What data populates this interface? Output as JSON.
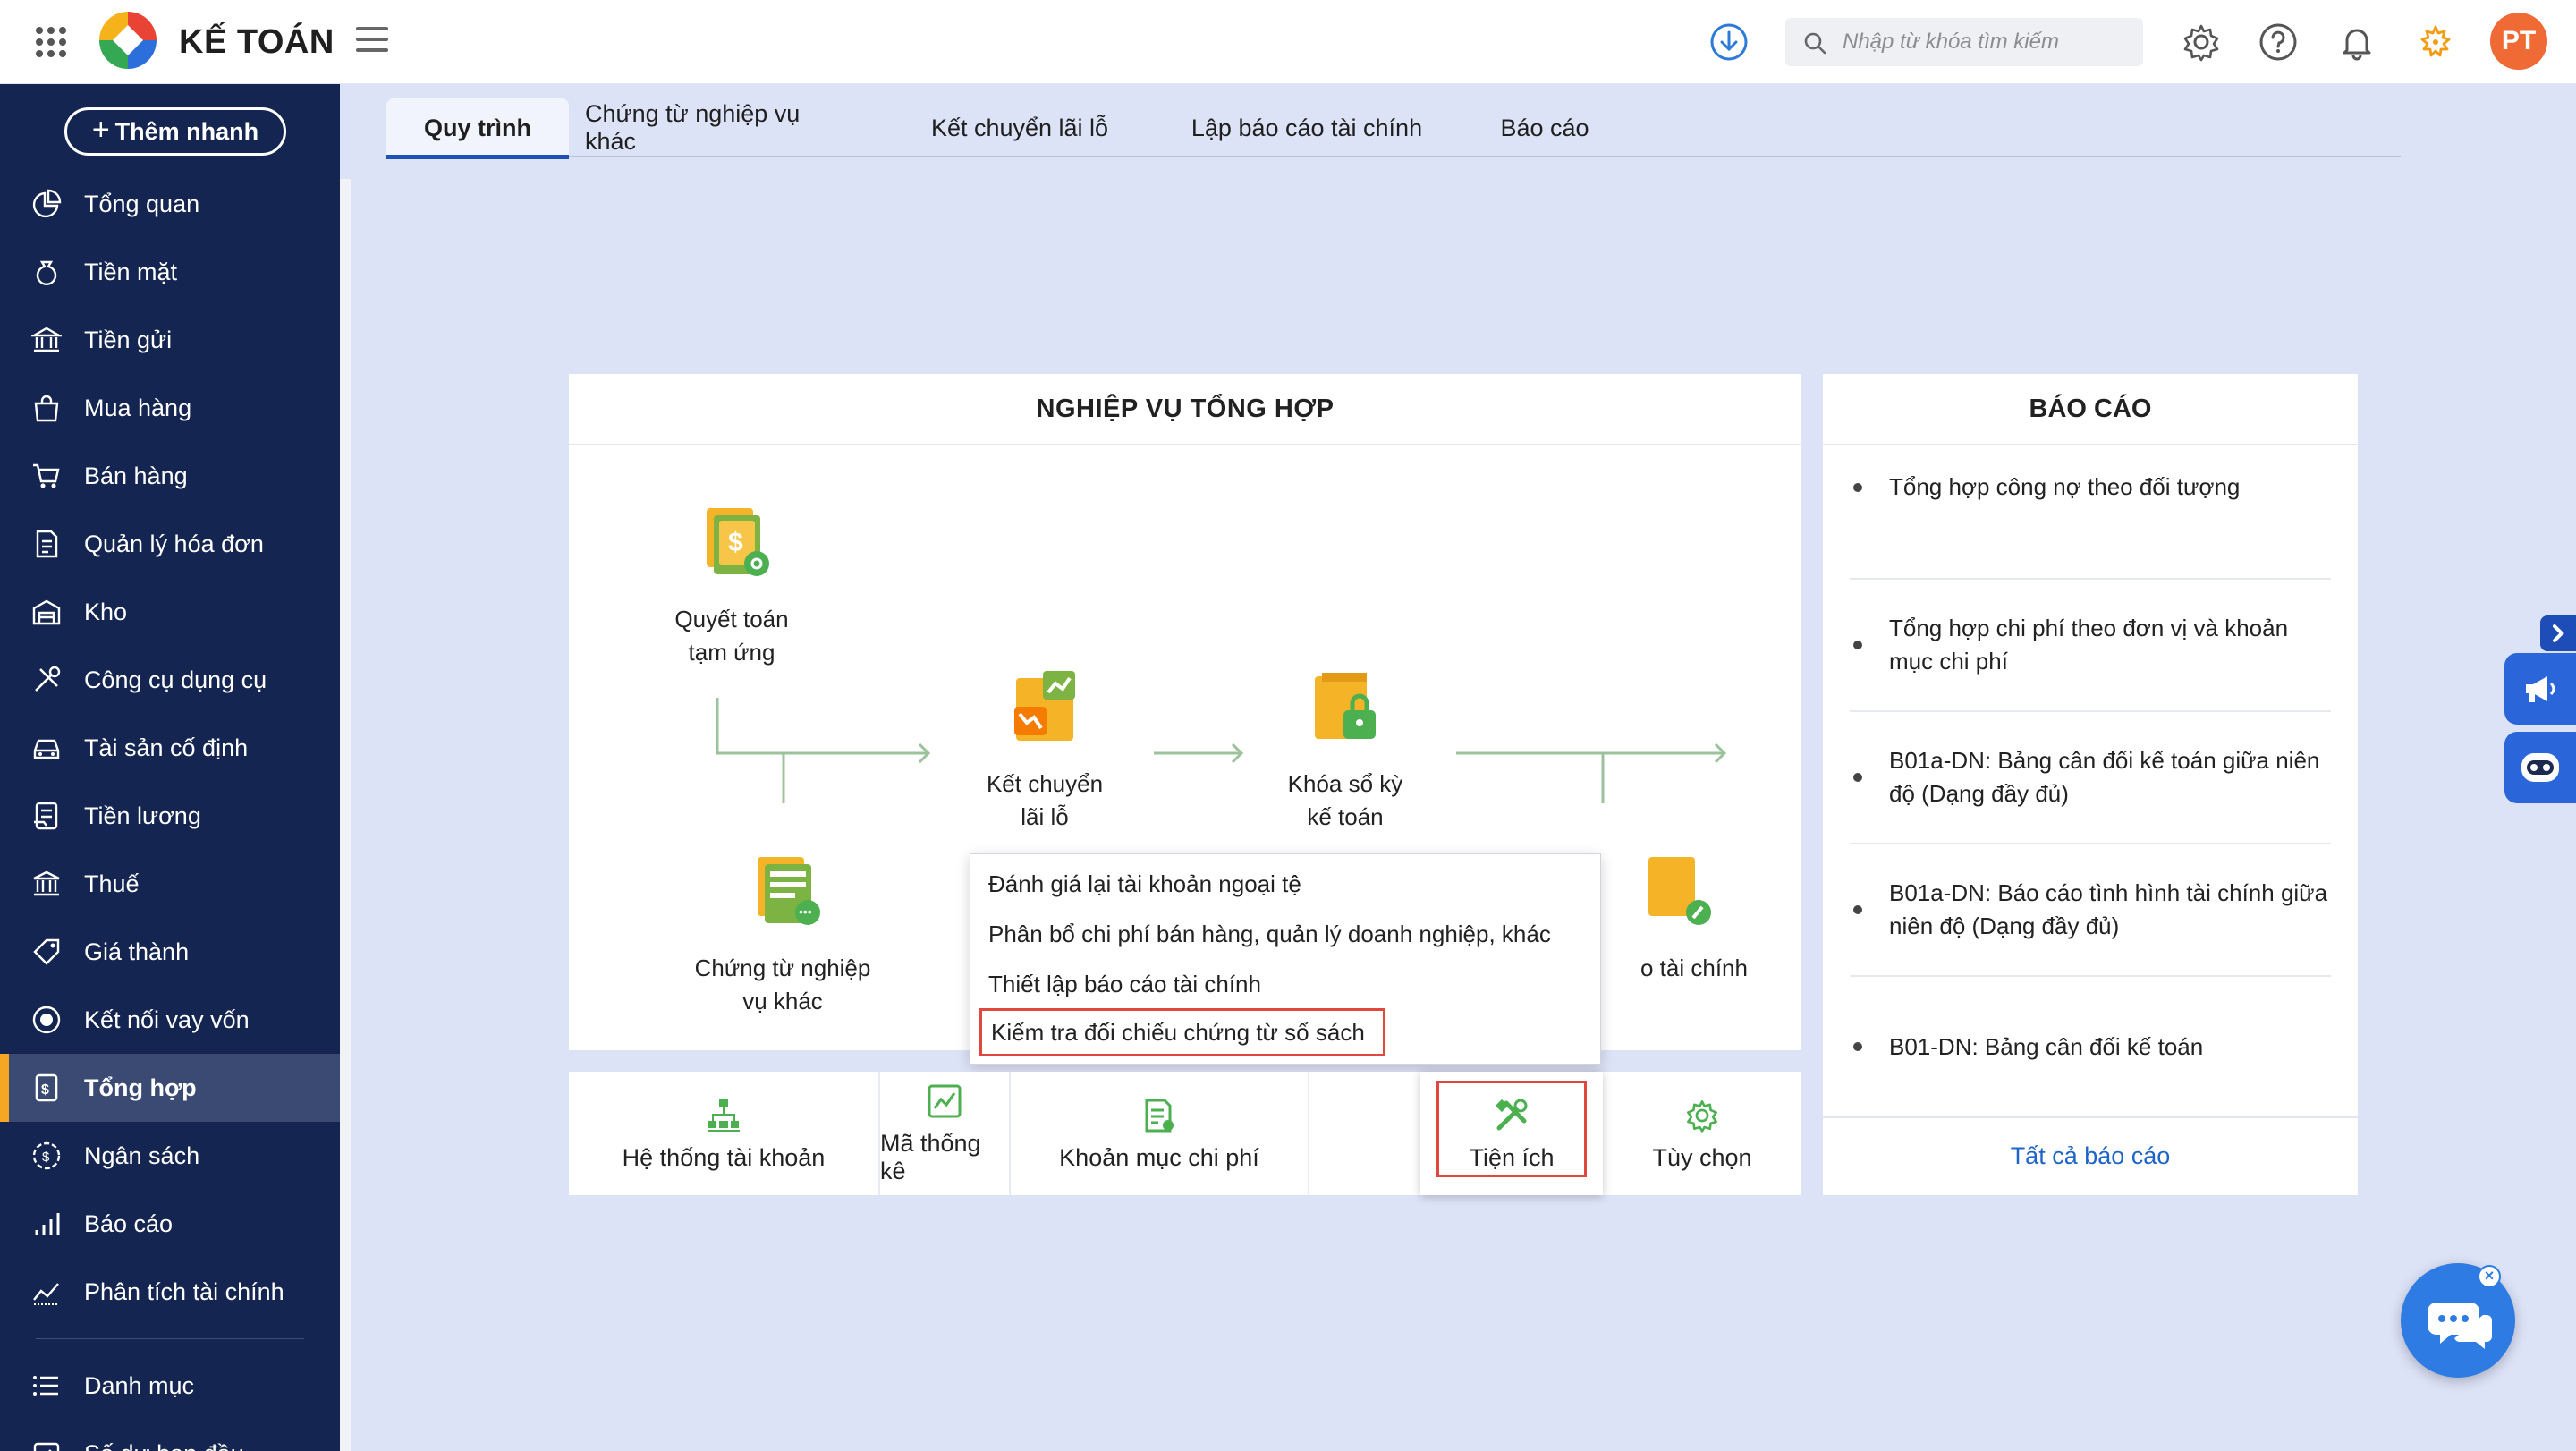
{
  "app": {
    "title": "KẾ TOÁN"
  },
  "search": {
    "placeholder": "Nhập từ khóa tìm kiếm"
  },
  "user": {
    "initials": "PT"
  },
  "sidebar": {
    "add_label": "Thêm nhanh",
    "items": [
      {
        "label": "Tổng quan",
        "icon": "chart-pie-icon"
      },
      {
        "label": "Tiền mặt",
        "icon": "money-bag-icon"
      },
      {
        "label": "Tiền gửi",
        "icon": "bank-icon"
      },
      {
        "label": "Mua hàng",
        "icon": "shopping-bag-icon"
      },
      {
        "label": "Bán hàng",
        "icon": "cart-icon"
      },
      {
        "label": "Quản lý hóa đơn",
        "icon": "invoice-icon"
      },
      {
        "label": "Kho",
        "icon": "warehouse-icon"
      },
      {
        "label": "Công cụ dụng cụ",
        "icon": "tools-icon"
      },
      {
        "label": "Tài sản cố định",
        "icon": "car-icon"
      },
      {
        "label": "Tiền lương",
        "icon": "salary-icon"
      },
      {
        "label": "Thuế",
        "icon": "tax-icon"
      },
      {
        "label": "Giá thành",
        "icon": "price-tag-icon"
      },
      {
        "label": "Kết nối vay vốn",
        "icon": "loan-icon"
      },
      {
        "label": "Tổng hợp",
        "icon": "ledger-icon",
        "active": true
      },
      {
        "label": "Ngân sách",
        "icon": "budget-icon"
      },
      {
        "label": "Báo cáo",
        "icon": "bar-chart-icon"
      },
      {
        "label": "Phân tích tài chính",
        "icon": "analysis-icon"
      }
    ],
    "bottom_items": [
      {
        "label": "Danh mục",
        "icon": "list-icon"
      },
      {
        "label": "Số dư ban đầu",
        "icon": "opening-balance-icon"
      }
    ]
  },
  "tabs": [
    {
      "label": "Quy trình",
      "active": true
    },
    {
      "label": "Chứng từ nghiệp vụ khác"
    },
    {
      "label": "Kết chuyển lãi lỗ"
    },
    {
      "label": "Lập báo cáo tài chính"
    },
    {
      "label": "Báo cáo"
    }
  ],
  "process": {
    "title": "NGHIỆP VỤ TỔNG HỢP",
    "nodes": {
      "advance": "Quyết toán tạm ứng",
      "profit_loss": "Kết chuyển lãi lỗ",
      "lock": "Khóa sổ kỳ kế toán",
      "other_docs": "Chứng từ nghiệp vụ khác",
      "fin_report_partial": "o tài chính"
    }
  },
  "dropdown": {
    "items": [
      "Đánh giá lại tài khoản ngoại tệ",
      "Phân bổ chi phí bán hàng, quản lý doanh nghiệp, khác",
      "Thiết lập báo cáo tài chính",
      "Kiểm tra đối chiếu chứng từ sổ sách"
    ]
  },
  "utilities": [
    {
      "label": "Hệ thống tài khoản",
      "icon": "account-tree-icon"
    },
    {
      "label": "Mã thống kê",
      "icon": "stats-code-icon"
    },
    {
      "label": "Khoản mục chi phí",
      "icon": "expense-item-icon"
    },
    {
      "label": "Tiện ích",
      "icon": "utility-tools-icon",
      "active": true
    },
    {
      "label": "Tùy chọn",
      "icon": "settings-icon"
    }
  ],
  "reports": {
    "title": "BÁO CÁO",
    "items": [
      "Tổng hợp công nợ theo đối tượng",
      "Tổng hợp chi phí theo đơn vị và khoản mục chi phí",
      "B01a-DN: Bảng cân đối kế toán giữa niên độ (Dạng đầy đủ)",
      "B01a-DN: Báo cáo tình hình tài chính giữa niên độ (Dạng đầy đủ)",
      "B01-DN: Bảng cân đối kế toán"
    ],
    "all_link": "Tất cả báo cáo"
  },
  "colors": {
    "sidebar_bg": "#142551",
    "active_accent": "#f5a623",
    "highlight_border": "#e0473f",
    "link": "#1f65c7",
    "page_bg": "#dde3f7"
  }
}
